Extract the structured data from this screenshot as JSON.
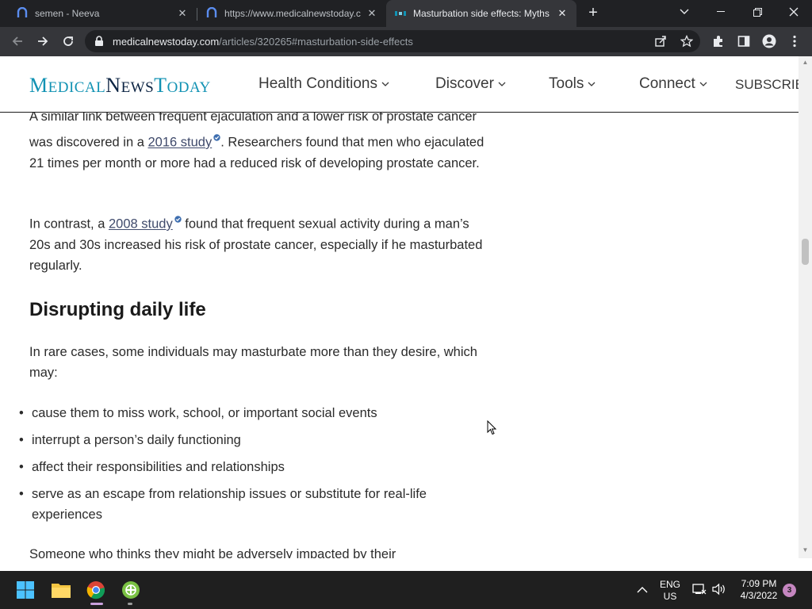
{
  "browser": {
    "tabs": [
      {
        "title": "semen - Neeva",
        "icon": "neeva-icon"
      },
      {
        "title": "https://www.medicalnewstoday.c",
        "icon": "neeva-icon"
      },
      {
        "title": "Masturbation side effects: Myths",
        "icon": "mnt-icon"
      }
    ],
    "url_domain": "medicalnewstoday.com",
    "url_path": "/articles/320265#masturbation-side-effects"
  },
  "site": {
    "logo_parts": {
      "m": "M",
      "edical": "EDICAL",
      "n": "N",
      "ews": "EWS",
      "t": "T",
      "oday": "ODAY"
    },
    "nav": [
      {
        "label": "Health Conditions"
      },
      {
        "label": "Discover"
      },
      {
        "label": "Tools"
      },
      {
        "label": "Connect"
      },
      {
        "label": "SUBSCRIBE"
      }
    ]
  },
  "article": {
    "p1_before": "A similar link between frequent ejaculation and a lower risk of prostate cancer was discovered in a ",
    "p1_link": "2016 study",
    "p1_after": ". Researchers found that men who ejaculated 21 times per month or more had a reduced risk of developing prostate cancer.",
    "p2_before": "In contrast, a ",
    "p2_link": "2008 study",
    "p2_after": " found that frequent sexual activity during a man’s 20s and 30s increased his risk of prostate cancer, especially if he masturbated regularly.",
    "heading": "Disrupting daily life",
    "p3": "In rare cases, some individuals may masturbate more than they desire, which may:",
    "bullets": [
      "cause them to miss work, school, or important social events",
      "interrupt a person’s daily functioning",
      "affect their responsibilities and relationships",
      "serve as an escape from relationship issues or substitute for real-life experiences"
    ],
    "p4_partial": "Someone who thinks they might be adversely impacted by their"
  },
  "taskbar": {
    "lang": "ENG",
    "region": "US",
    "time": "7:09 PM",
    "date": "4/3/2022",
    "notifications": "3"
  },
  "colors": {
    "brand_blue": "#1192b3",
    "brand_navy": "#0c2443",
    "chrome_dark": "#202124",
    "chrome_mid": "#35363a"
  }
}
